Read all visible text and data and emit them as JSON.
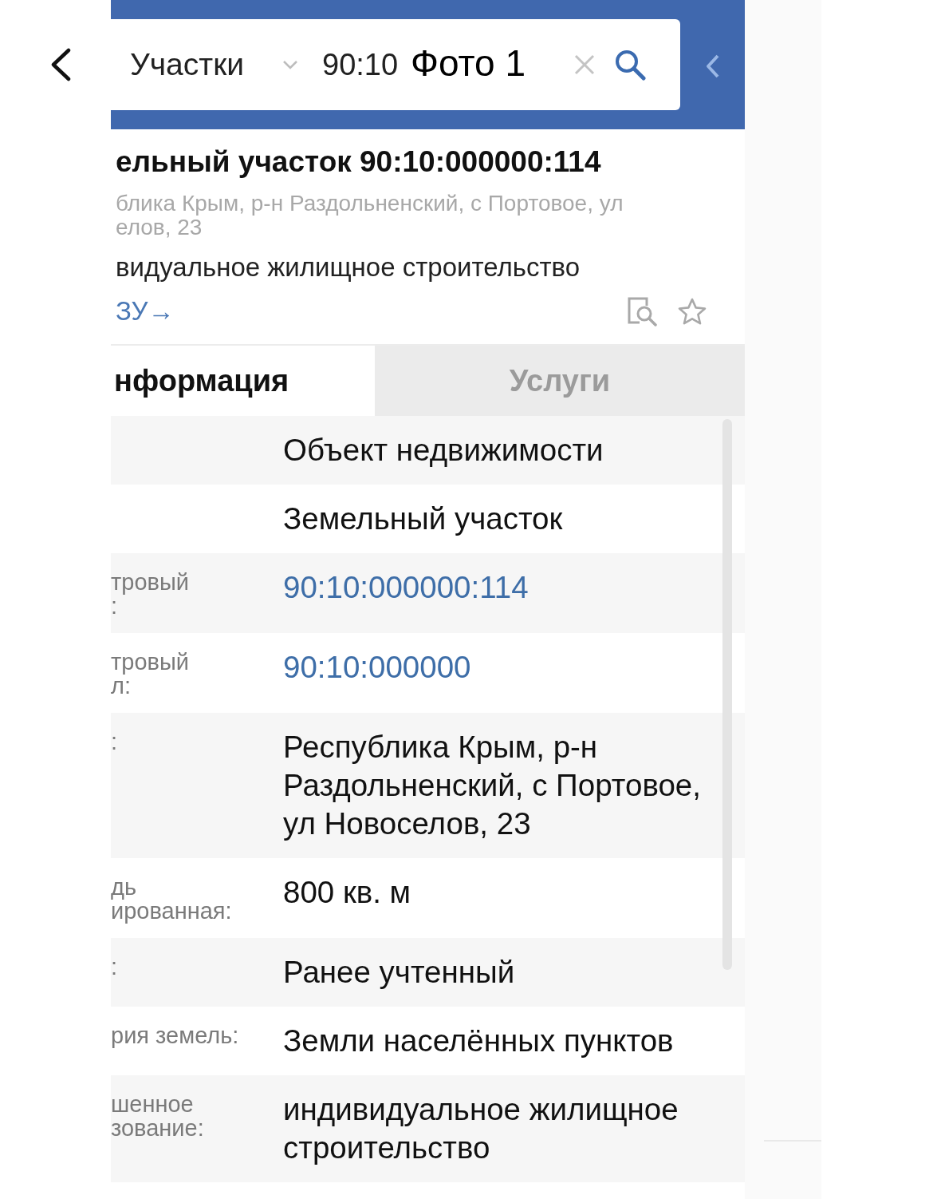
{
  "viewer": {
    "title": "Фото 1"
  },
  "search": {
    "category": "Участки",
    "value": "90:10"
  },
  "object": {
    "title": "ельный участок 90:10:000000:114",
    "address": "блика Крым, р-н Раздольненский, с Портовое, ул\nелов, 23",
    "purpose": "видуальное жилищное строительство",
    "link": "ЗУ→"
  },
  "tabs": [
    {
      "label": "нформация",
      "selected": true
    },
    {
      "label": "Услуги",
      "selected": false
    }
  ],
  "rows": [
    {
      "value": "Объект недвижимости",
      "kind": "text"
    },
    {
      "value": "Земельный участок",
      "kind": "text"
    },
    {
      "label": "тровый\n:",
      "value": "90:10:000000:114",
      "kind": "link"
    },
    {
      "label": "тровый\nл:",
      "value": "90:10:000000",
      "kind": "link"
    },
    {
      "label": ":",
      "value": "Республика Крым, р-н\nРаздольненский, с Портовое,\nул Новоселов, 23",
      "kind": "text"
    },
    {
      "label": "дь\nированная:",
      "value": "800 кв. м",
      "kind": "text"
    },
    {
      "label": ":",
      "value": "Ранее учтенный",
      "kind": "text"
    },
    {
      "label": "рия земель:",
      "value": "Земли населённых пунктов",
      "kind": "text"
    },
    {
      "label": "шенное\nзование:",
      "value": "индивидуальное жилищное\nстроительство",
      "kind": "text"
    }
  ]
}
